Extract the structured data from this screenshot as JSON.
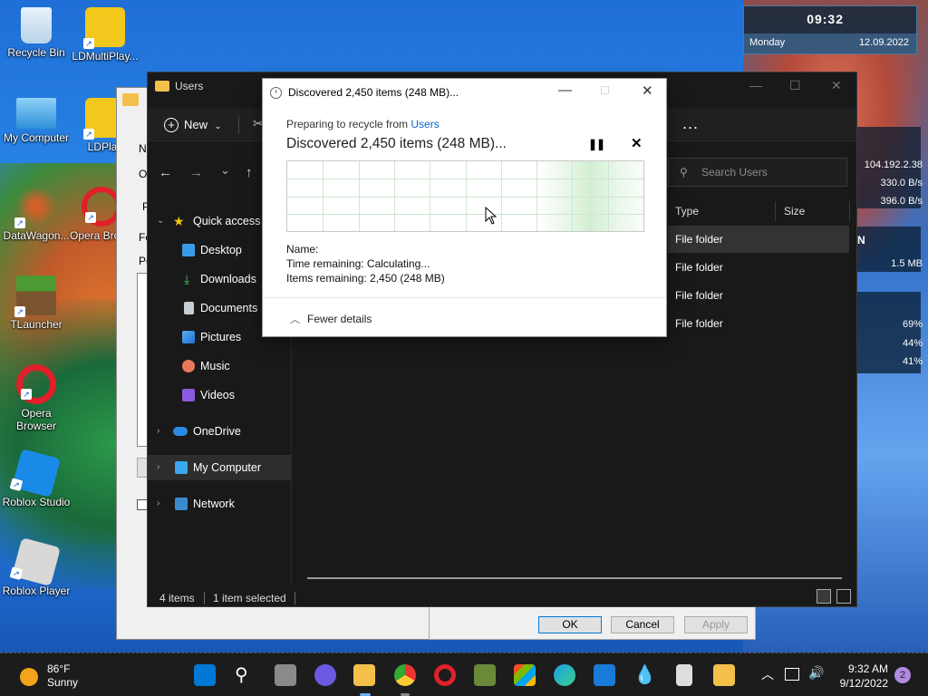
{
  "desktop": {
    "icons": [
      {
        "label": "Recycle Bin"
      },
      {
        "label": "LDMultiPlay..."
      },
      {
        "label": "My Computer"
      },
      {
        "label": "LDPlay"
      },
      {
        "label": "DataWagon..."
      },
      {
        "label": "Opera Brows"
      },
      {
        "label": "TLauncher"
      },
      {
        "label": "Opera Browser"
      },
      {
        "label": "Roblox Studio"
      },
      {
        "label": "Roblox Player"
      }
    ]
  },
  "widget": {
    "time": "09:32",
    "day": "Monday",
    "date": "12.09.2022",
    "ip": "104.192.2.38",
    "upload": "330.0 B/s",
    "download": "396.0 B/s",
    "net_label": "N",
    "size": "1.5 MB",
    "cpu": "69%",
    "mem": "44%",
    "disk": "41%"
  },
  "explorer": {
    "title": "Users",
    "new_label": "New",
    "more": "...",
    "search_placeholder": "Search Users",
    "sidebar": [
      {
        "label": "Quick access"
      },
      {
        "label": "Desktop"
      },
      {
        "label": "Downloads"
      },
      {
        "label": "Documents"
      },
      {
        "label": "Pictures"
      },
      {
        "label": "Music"
      },
      {
        "label": "Videos"
      },
      {
        "label": "OneDrive"
      },
      {
        "label": "My Computer"
      },
      {
        "label": "Network"
      }
    ],
    "columns": {
      "type": "Type",
      "size": "Size"
    },
    "rows": [
      {
        "type": "File folder"
      },
      {
        "type": "File folder"
      },
      {
        "type": "File folder"
      },
      {
        "type": "File folder"
      }
    ],
    "status_items": "4 items",
    "status_selected": "1 item selected"
  },
  "properties": {
    "ok": "OK",
    "cancel": "Cancel",
    "apply": "Apply",
    "side_letters": [
      "N",
      "O",
      "P",
      "Fo",
      "Pe"
    ]
  },
  "progress": {
    "title": "Discovered 2,450 items (248 MB)...",
    "prep_prefix": "Preparing to recycle from ",
    "prep_link": "Users",
    "heading": "Discovered 2,450 items (248 MB)...",
    "name_label": "Name:",
    "time_remaining": "Time remaining:  Calculating...",
    "items_remaining": "Items remaining:  2,450 (248 MB)",
    "fewer_details": "Fewer details"
  },
  "taskbar": {
    "temp": "86°F",
    "condition": "Sunny",
    "time": "9:32 AM",
    "date": "9/12/2022",
    "notifications": "2"
  },
  "colors": {
    "accent": "#0078d4",
    "explorer_bg": "#191919",
    "link": "#0066cc"
  }
}
